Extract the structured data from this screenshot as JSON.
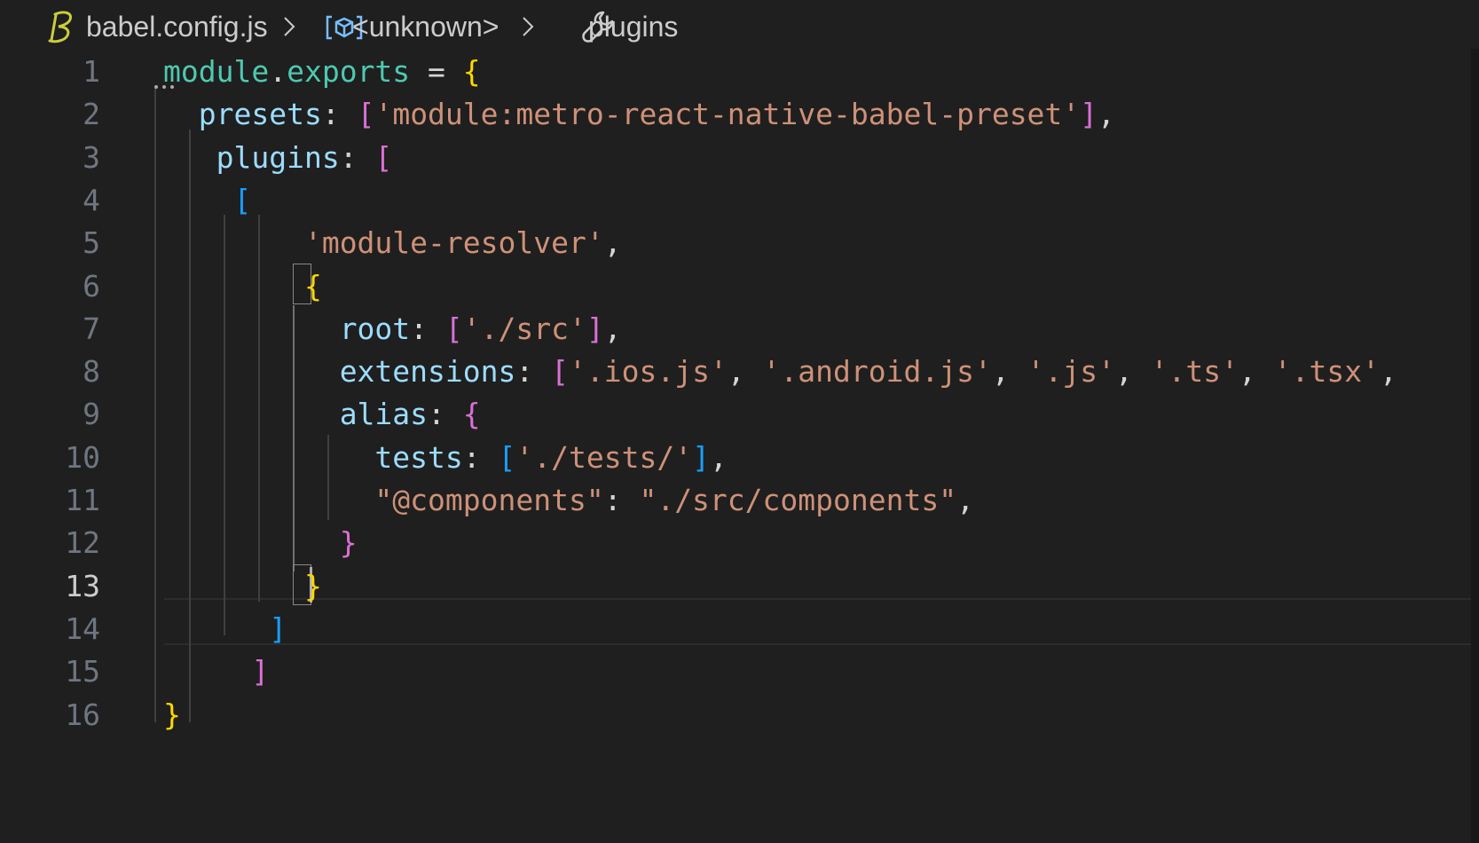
{
  "breadcrumb": {
    "file": "babel.config.js",
    "symbol": "<unknown>",
    "current": "plugins"
  },
  "editor": {
    "active_line": 13,
    "lines": [
      {
        "n": "1",
        "tokens": [
          {
            "t": "module",
            "c": "fn"
          },
          {
            "t": ".",
            "c": "pl"
          },
          {
            "t": "exports",
            "c": "fn"
          },
          {
            "t": " = ",
            "c": "pl"
          },
          {
            "t": "{",
            "c": "b1"
          }
        ]
      },
      {
        "n": "2",
        "tokens": [
          {
            "t": "  ",
            "c": "pl"
          },
          {
            "t": "presets",
            "c": "pn"
          },
          {
            "t": ": ",
            "c": "pl"
          },
          {
            "t": "[",
            "c": "b2"
          },
          {
            "t": "'module:metro-react-native-babel-preset'",
            "c": "st"
          },
          {
            "t": "]",
            "c": "b2"
          },
          {
            "t": ",",
            "c": "pl"
          }
        ]
      },
      {
        "n": "3",
        "tokens": [
          {
            "t": "   ",
            "c": "pl"
          },
          {
            "t": "plugins",
            "c": "pn"
          },
          {
            "t": ": ",
            "c": "pl"
          },
          {
            "t": "[",
            "c": "b2"
          }
        ]
      },
      {
        "n": "4",
        "tokens": [
          {
            "t": "    ",
            "c": "pl"
          },
          {
            "t": "[",
            "c": "b3"
          }
        ]
      },
      {
        "n": "5",
        "tokens": [
          {
            "t": "        ",
            "c": "pl"
          },
          {
            "t": "'module-resolver'",
            "c": "st"
          },
          {
            "t": ",",
            "c": "pl"
          }
        ]
      },
      {
        "n": "6",
        "tokens": [
          {
            "t": "        ",
            "c": "pl"
          },
          {
            "t": "{",
            "c": "b1"
          }
        ]
      },
      {
        "n": "7",
        "tokens": [
          {
            "t": "          ",
            "c": "pl"
          },
          {
            "t": "root",
            "c": "pn"
          },
          {
            "t": ": ",
            "c": "pl"
          },
          {
            "t": "[",
            "c": "b2"
          },
          {
            "t": "'./src'",
            "c": "st"
          },
          {
            "t": "]",
            "c": "b2"
          },
          {
            "t": ",",
            "c": "pl"
          }
        ]
      },
      {
        "n": "8",
        "tokens": [
          {
            "t": "          ",
            "c": "pl"
          },
          {
            "t": "extensions",
            "c": "pn"
          },
          {
            "t": ": ",
            "c": "pl"
          },
          {
            "t": "[",
            "c": "b2"
          },
          {
            "t": "'.ios.js'",
            "c": "st"
          },
          {
            "t": ", ",
            "c": "pl"
          },
          {
            "t": "'.android.js'",
            "c": "st"
          },
          {
            "t": ", ",
            "c": "pl"
          },
          {
            "t": "'.js'",
            "c": "st"
          },
          {
            "t": ", ",
            "c": "pl"
          },
          {
            "t": "'.ts'",
            "c": "st"
          },
          {
            "t": ", ",
            "c": "pl"
          },
          {
            "t": "'.tsx'",
            "c": "st"
          },
          {
            "t": ",",
            "c": "pl"
          }
        ]
      },
      {
        "n": "9",
        "tokens": [
          {
            "t": "          ",
            "c": "pl"
          },
          {
            "t": "alias",
            "c": "pn"
          },
          {
            "t": ": ",
            "c": "pl"
          },
          {
            "t": "{",
            "c": "b2"
          }
        ]
      },
      {
        "n": "10",
        "tokens": [
          {
            "t": "            ",
            "c": "pl"
          },
          {
            "t": "tests",
            "c": "pn"
          },
          {
            "t": ": ",
            "c": "pl"
          },
          {
            "t": "[",
            "c": "b3"
          },
          {
            "t": "'./tests/'",
            "c": "st"
          },
          {
            "t": "]",
            "c": "b3"
          },
          {
            "t": ",",
            "c": "pl"
          }
        ]
      },
      {
        "n": "11",
        "tokens": [
          {
            "t": "            ",
            "c": "pl"
          },
          {
            "t": "\"@components\"",
            "c": "st"
          },
          {
            "t": ": ",
            "c": "pl"
          },
          {
            "t": "\"./src/components\"",
            "c": "st"
          },
          {
            "t": ",",
            "c": "pl"
          }
        ]
      },
      {
        "n": "12",
        "tokens": [
          {
            "t": "          ",
            "c": "pl"
          },
          {
            "t": "}",
            "c": "b2"
          }
        ]
      },
      {
        "n": "13",
        "tokens": [
          {
            "t": "        ",
            "c": "pl"
          },
          {
            "t": "}",
            "c": "b1"
          }
        ]
      },
      {
        "n": "14",
        "tokens": [
          {
            "t": "      ",
            "c": "pl"
          },
          {
            "t": "]",
            "c": "b3"
          }
        ]
      },
      {
        "n": "15",
        "tokens": [
          {
            "t": "     ",
            "c": "pl"
          },
          {
            "t": "]",
            "c": "b2"
          }
        ]
      },
      {
        "n": "16",
        "tokens": [
          {
            "t": "}",
            "c": "b1"
          }
        ]
      }
    ]
  },
  "colors": {
    "background": "#1f1f1f",
    "property": "#9cdcfe",
    "identifier": "#4ec9b0",
    "string": "#ce9178",
    "bracket_level1": "#ffd700",
    "bracket_level2": "#da70d6",
    "bracket_level3": "#179fff"
  },
  "icons": {
    "file": "babel-icon",
    "symbol": "object-symbol-icon",
    "current": "wrench-icon",
    "separator": "chevron-right-icon"
  }
}
